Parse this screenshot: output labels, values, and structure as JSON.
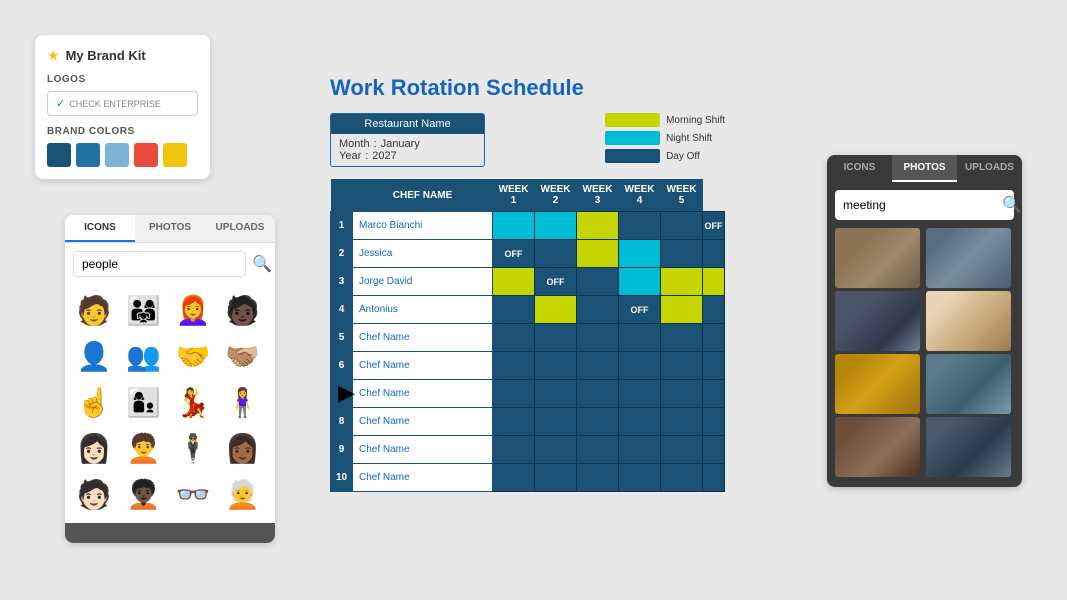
{
  "brandKit": {
    "title": "My Brand Kit",
    "sections": {
      "logos": "LOGOS",
      "checkEnterprise": "CHECK ENTERPRISE",
      "brandColors": "BRAND COLORS"
    },
    "colors": [
      "#1a5276",
      "#2471a3",
      "#7fb3d3",
      "#e74c3c",
      "#f1c40f"
    ]
  },
  "iconsPanel": {
    "tabs": [
      "ICONS",
      "PHOTOS",
      "UPLOADS"
    ],
    "activeTab": "ICONS",
    "searchValue": "people",
    "searchPlaceholder": "people"
  },
  "schedule": {
    "title": "Work Rotation Schedule",
    "restaurantLabel": "Restaurant Name",
    "month": "Month",
    "monthColon": ":",
    "monthValue": "January",
    "year": "Year",
    "yearColon": ":",
    "yearValue": "2027",
    "legend": [
      {
        "label": "Morning Shift",
        "color": "#c6d400"
      },
      {
        "label": "Night Shift",
        "color": "#00bcd4"
      },
      {
        "label": "Day Off",
        "color": "#1a5276"
      }
    ],
    "headers": {
      "chefName": "CHEF NAME",
      "week1": "WEEK 1",
      "week2": "WEEK 2",
      "week3": "WEEK 3",
      "week4": "WEEK 4",
      "week5": "WEEK 5"
    },
    "rows": [
      {
        "num": 1,
        "name": "Marco Bianchi",
        "cells": [
          "cyan",
          "cyan",
          "lime",
          "navy",
          "navy",
          "off"
        ]
      },
      {
        "num": 2,
        "name": "Jessica",
        "cells": [
          "off",
          "navy",
          "lime",
          "cyan",
          "navy",
          "navy"
        ]
      },
      {
        "num": 3,
        "name": "Jorge David",
        "cells": [
          "lime",
          "off",
          "navy",
          "cyan",
          "lime",
          "lime"
        ]
      },
      {
        "num": 4,
        "name": "Antonius",
        "cells": [
          "navy",
          "lime",
          "navy",
          "off",
          "lime",
          "navy"
        ]
      },
      {
        "num": 5,
        "name": "Chef Name",
        "cells": [
          "navy",
          "navy",
          "navy",
          "navy",
          "navy",
          "navy"
        ]
      },
      {
        "num": 6,
        "name": "Chef Name",
        "cells": [
          "navy",
          "navy",
          "navy",
          "navy",
          "navy",
          "navy"
        ]
      },
      {
        "num": 7,
        "name": "Chef Name",
        "cells": [
          "navy",
          "navy",
          "navy",
          "navy",
          "navy",
          "navy"
        ]
      },
      {
        "num": 8,
        "name": "Chef Name",
        "cells": [
          "navy",
          "navy",
          "navy",
          "navy",
          "navy",
          "navy"
        ]
      },
      {
        "num": 9,
        "name": "Chef Name",
        "cells": [
          "navy",
          "navy",
          "navy",
          "navy",
          "navy",
          "navy"
        ]
      },
      {
        "num": 10,
        "name": "Chef Name",
        "cells": [
          "navy",
          "navy",
          "navy",
          "navy",
          "navy",
          "navy"
        ]
      }
    ]
  },
  "photosPanel": {
    "tabs": [
      "ICONS",
      "PHOTOS",
      "UPLOADS"
    ],
    "activeTab": "PHOTOS",
    "searchValue": "meeting",
    "searchPlaceholder": "meeting"
  },
  "icons": [
    "🧑",
    "👨‍👩‍👧‍👦",
    "👩",
    "🧑🏿",
    "👤",
    "👥",
    "🤝",
    "🫱🏽‍🫲🏼",
    "☝️",
    "👩‍👦",
    "💃",
    "🧍‍♀️",
    "👩🏻",
    "🧑‍🦱",
    "🕴️",
    "👩🏾",
    "👩‍🦰",
    "👩🏿",
    "🧑🏻",
    "🧑‍🦳"
  ]
}
